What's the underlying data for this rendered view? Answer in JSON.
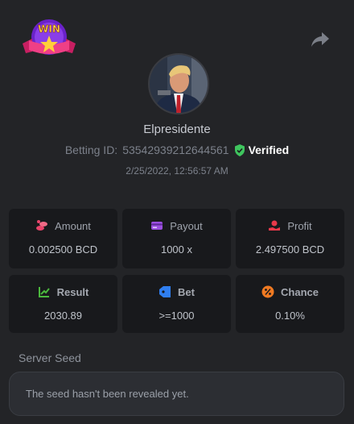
{
  "header": {
    "logo_text": "WIN",
    "share_icon": "share-icon"
  },
  "user": {
    "name": "Elpresidente",
    "betting_id_label": "Betting ID:",
    "betting_id": "53542939212644561",
    "verified_label": "Verified",
    "timestamp": "2/25/2022, 12:56:57 AM"
  },
  "stats": [
    {
      "label": "Amount",
      "value": "0.002500 BCD",
      "icon": "coins-icon",
      "color": "#e8446a"
    },
    {
      "label": "Payout",
      "value": "1000 x",
      "icon": "card-icon",
      "color": "#9b4fe0"
    },
    {
      "label": "Profit",
      "value": "2.497500 BCD",
      "icon": "hand-coin-icon",
      "color": "#e8394a"
    },
    {
      "label": "Result",
      "value": "2030.89",
      "icon": "chart-icon",
      "color": "#4bb83d"
    },
    {
      "label": "Bet",
      "value": ">=1000",
      "icon": "tag-icon",
      "color": "#2f7ef0"
    },
    {
      "label": "Chance",
      "value": "0.10%",
      "icon": "percent-icon",
      "color": "#f07a22"
    }
  ],
  "server_seed": {
    "label": "Server Seed",
    "message": "The seed hasn't been revealed yet."
  },
  "colors": {
    "background": "#232427",
    "card": "#18191c",
    "verified": "#3fc55e"
  }
}
